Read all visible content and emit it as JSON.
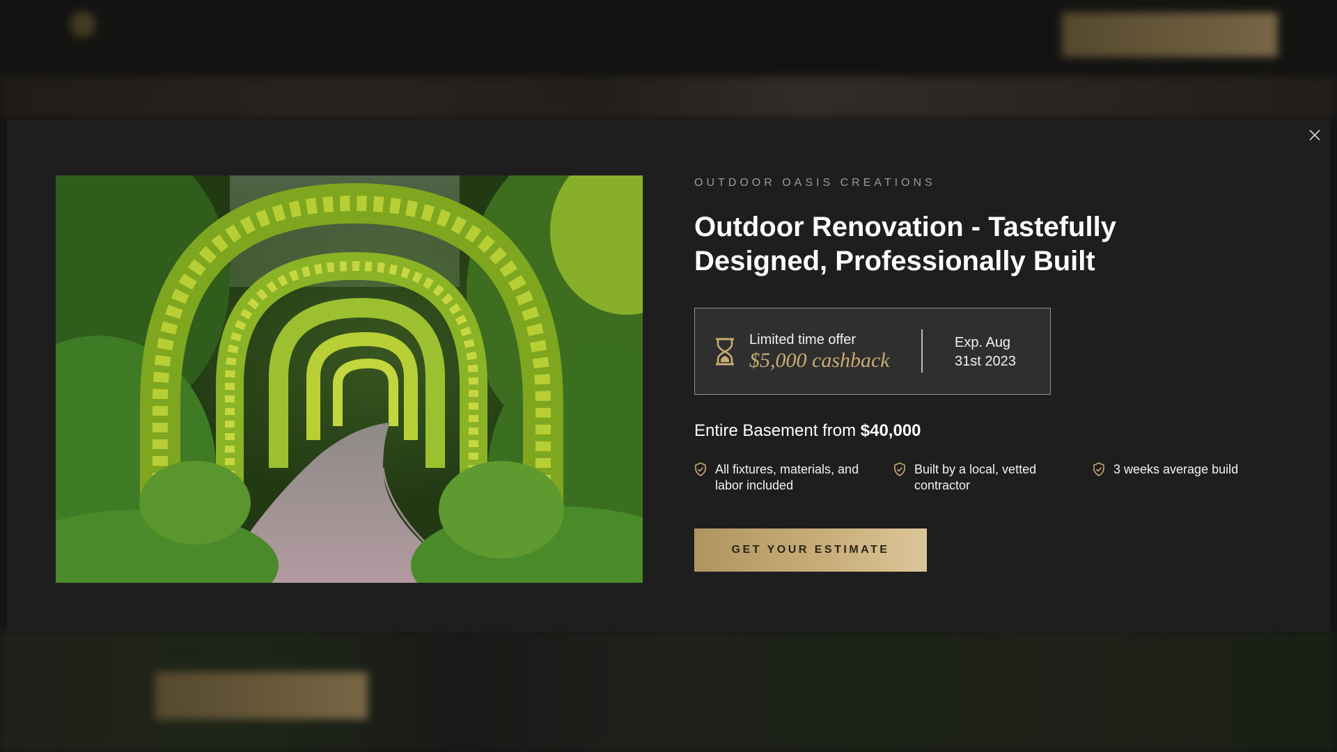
{
  "modal": {
    "eyebrow": "OUTDOOR OASIS CREATIONS",
    "headline": "Outdoor Renovation - Tastefully Designed, Professionally Built",
    "offer": {
      "label": "Limited time offer",
      "value": "$5,000 cashback",
      "expiry_line1": "Exp. Aug",
      "expiry_line2": "31st 2023",
      "icon": "hourglass-icon"
    },
    "price": {
      "prefix": "Entire Basement from ",
      "amount": "$40,000"
    },
    "features": [
      {
        "text": "All fixtures, materials, and labor included",
        "icon": "shield-check-icon"
      },
      {
        "text": "Built by a local, vetted contractor",
        "icon": "shield-check-icon"
      },
      {
        "text": "3 weeks average build",
        "icon": "shield-check-icon"
      }
    ],
    "cta_label": "GET YOUR ESTIMATE",
    "close_icon": "close-icon",
    "image_icon": "garden-archway-photo"
  },
  "colors": {
    "accent_gold": "#c9ac6f",
    "modal_bg": "#1e1e1e",
    "offer_bg": "#2f2f2f"
  }
}
